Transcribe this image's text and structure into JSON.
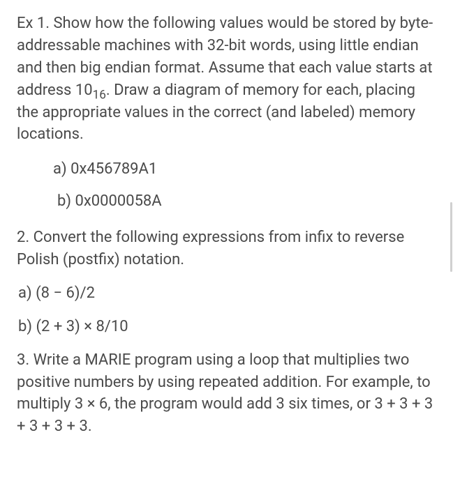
{
  "ex1": {
    "intro_p1": "Ex 1. Show how the following values would be stored by byte-addressable machines with 32-bit words, using little endian and then big endian format. Assume that each value starts at address 10",
    "intro_sub": "16",
    "intro_p2": ". Draw a diagram of memory for each, placing the appropriate values in the correct (and labeled) memory locations.",
    "a": "a) 0x456789A1",
    "b": "b) 0x0000058A"
  },
  "q2": {
    "intro": "2. Convert the following expressions from infix to reverse Polish (postfix) notation.",
    "a": "a) (8 − 6)/2",
    "b": "b) (2 + 3) × 8/10"
  },
  "q3": {
    "text": "3. Write a MARIE program using a loop that multiplies two positive numbers by using repeated addition. For example, to multiply 3 × 6, the program would add 3 six times, or 3 + 3 + 3 + 3 + 3 + 3."
  }
}
